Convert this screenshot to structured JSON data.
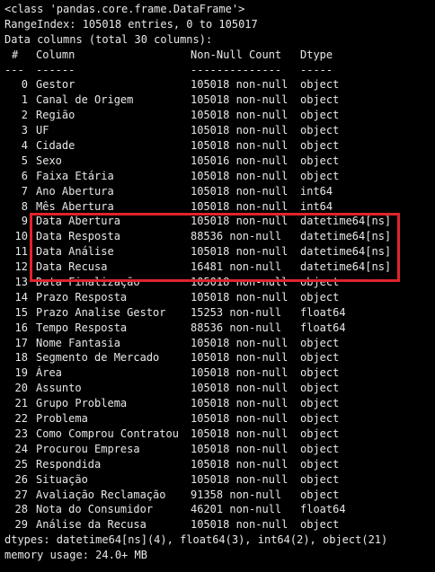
{
  "header": {
    "class_line": "<class 'pandas.core.frame.DataFrame'>",
    "range_index": "RangeIndex: 105018 entries, 0 to 105017",
    "data_columns": "Data columns (total 30 columns):"
  },
  "table": {
    "headers": {
      "idx": "#",
      "column": "Column",
      "non_null": "Non-Null Count",
      "dtype": "Dtype"
    },
    "separators": {
      "idx": "---",
      "column": "------",
      "non_null": "--------------",
      "dtype": "-----"
    },
    "rows": [
      {
        "idx": "0",
        "column": "Gestor",
        "non_null": "105018 non-null",
        "dtype": "object"
      },
      {
        "idx": "1",
        "column": "Canal de Origem",
        "non_null": "105018 non-null",
        "dtype": "object"
      },
      {
        "idx": "2",
        "column": "Região",
        "non_null": "105018 non-null",
        "dtype": "object"
      },
      {
        "idx": "3",
        "column": "UF",
        "non_null": "105018 non-null",
        "dtype": "object"
      },
      {
        "idx": "4",
        "column": "Cidade",
        "non_null": "105018 non-null",
        "dtype": "object"
      },
      {
        "idx": "5",
        "column": "Sexo",
        "non_null": "105016 non-null",
        "dtype": "object"
      },
      {
        "idx": "6",
        "column": "Faixa Etária",
        "non_null": "105018 non-null",
        "dtype": "object"
      },
      {
        "idx": "7",
        "column": "Ano Abertura",
        "non_null": "105018 non-null",
        "dtype": "int64"
      },
      {
        "idx": "8",
        "column": "Mês Abertura",
        "non_null": "105018 non-null",
        "dtype": "int64"
      },
      {
        "idx": "9",
        "column": "Data Abertura",
        "non_null": "105018 non-null",
        "dtype": "datetime64[ns]"
      },
      {
        "idx": "10",
        "column": "Data Resposta",
        "non_null": "88536 non-null",
        "dtype": "datetime64[ns]"
      },
      {
        "idx": "11",
        "column": "Data Análise",
        "non_null": "105018 non-null",
        "dtype": "datetime64[ns]"
      },
      {
        "idx": "12",
        "column": "Data Recusa",
        "non_null": "16481 non-null",
        "dtype": "datetime64[ns]"
      },
      {
        "idx": "13",
        "column": "Data Finalização",
        "non_null": "105018 non-null",
        "dtype": "object"
      },
      {
        "idx": "14",
        "column": "Prazo Resposta",
        "non_null": "105018 non-null",
        "dtype": "object"
      },
      {
        "idx": "15",
        "column": "Prazo Analise Gestor",
        "non_null": "15253 non-null",
        "dtype": "float64"
      },
      {
        "idx": "16",
        "column": "Tempo Resposta",
        "non_null": "88536 non-null",
        "dtype": "float64"
      },
      {
        "idx": "17",
        "column": "Nome Fantasia",
        "non_null": "105018 non-null",
        "dtype": "object"
      },
      {
        "idx": "18",
        "column": "Segmento de Mercado",
        "non_null": "105018 non-null",
        "dtype": "object"
      },
      {
        "idx": "19",
        "column": "Área",
        "non_null": "105018 non-null",
        "dtype": "object"
      },
      {
        "idx": "20",
        "column": "Assunto",
        "non_null": "105018 non-null",
        "dtype": "object"
      },
      {
        "idx": "21",
        "column": "Grupo Problema",
        "non_null": "105018 non-null",
        "dtype": "object"
      },
      {
        "idx": "22",
        "column": "Problema",
        "non_null": "105018 non-null",
        "dtype": "object"
      },
      {
        "idx": "23",
        "column": "Como Comprou Contratou",
        "non_null": "105018 non-null",
        "dtype": "object"
      },
      {
        "idx": "24",
        "column": "Procurou Empresa",
        "non_null": "105018 non-null",
        "dtype": "object"
      },
      {
        "idx": "25",
        "column": "Respondida",
        "non_null": "105018 non-null",
        "dtype": "object"
      },
      {
        "idx": "26",
        "column": "Situação",
        "non_null": "105018 non-null",
        "dtype": "object"
      },
      {
        "idx": "27",
        "column": "Avaliação Reclamação",
        "non_null": "91358 non-null",
        "dtype": "object"
      },
      {
        "idx": "28",
        "column": "Nota do Consumidor",
        "non_null": "46201 non-null",
        "dtype": "float64"
      },
      {
        "idx": "29",
        "column": "Análise da Recusa",
        "non_null": "105018 non-null",
        "dtype": "object"
      }
    ]
  },
  "footer": {
    "dtypes": "dtypes: datetime64[ns](4), float64(3), int64(2), object(21)",
    "memory": "memory usage: 24.0+ MB"
  },
  "colors": {
    "background": "#000000",
    "text": "#e8e8e8",
    "highlight": "#e0242b"
  }
}
